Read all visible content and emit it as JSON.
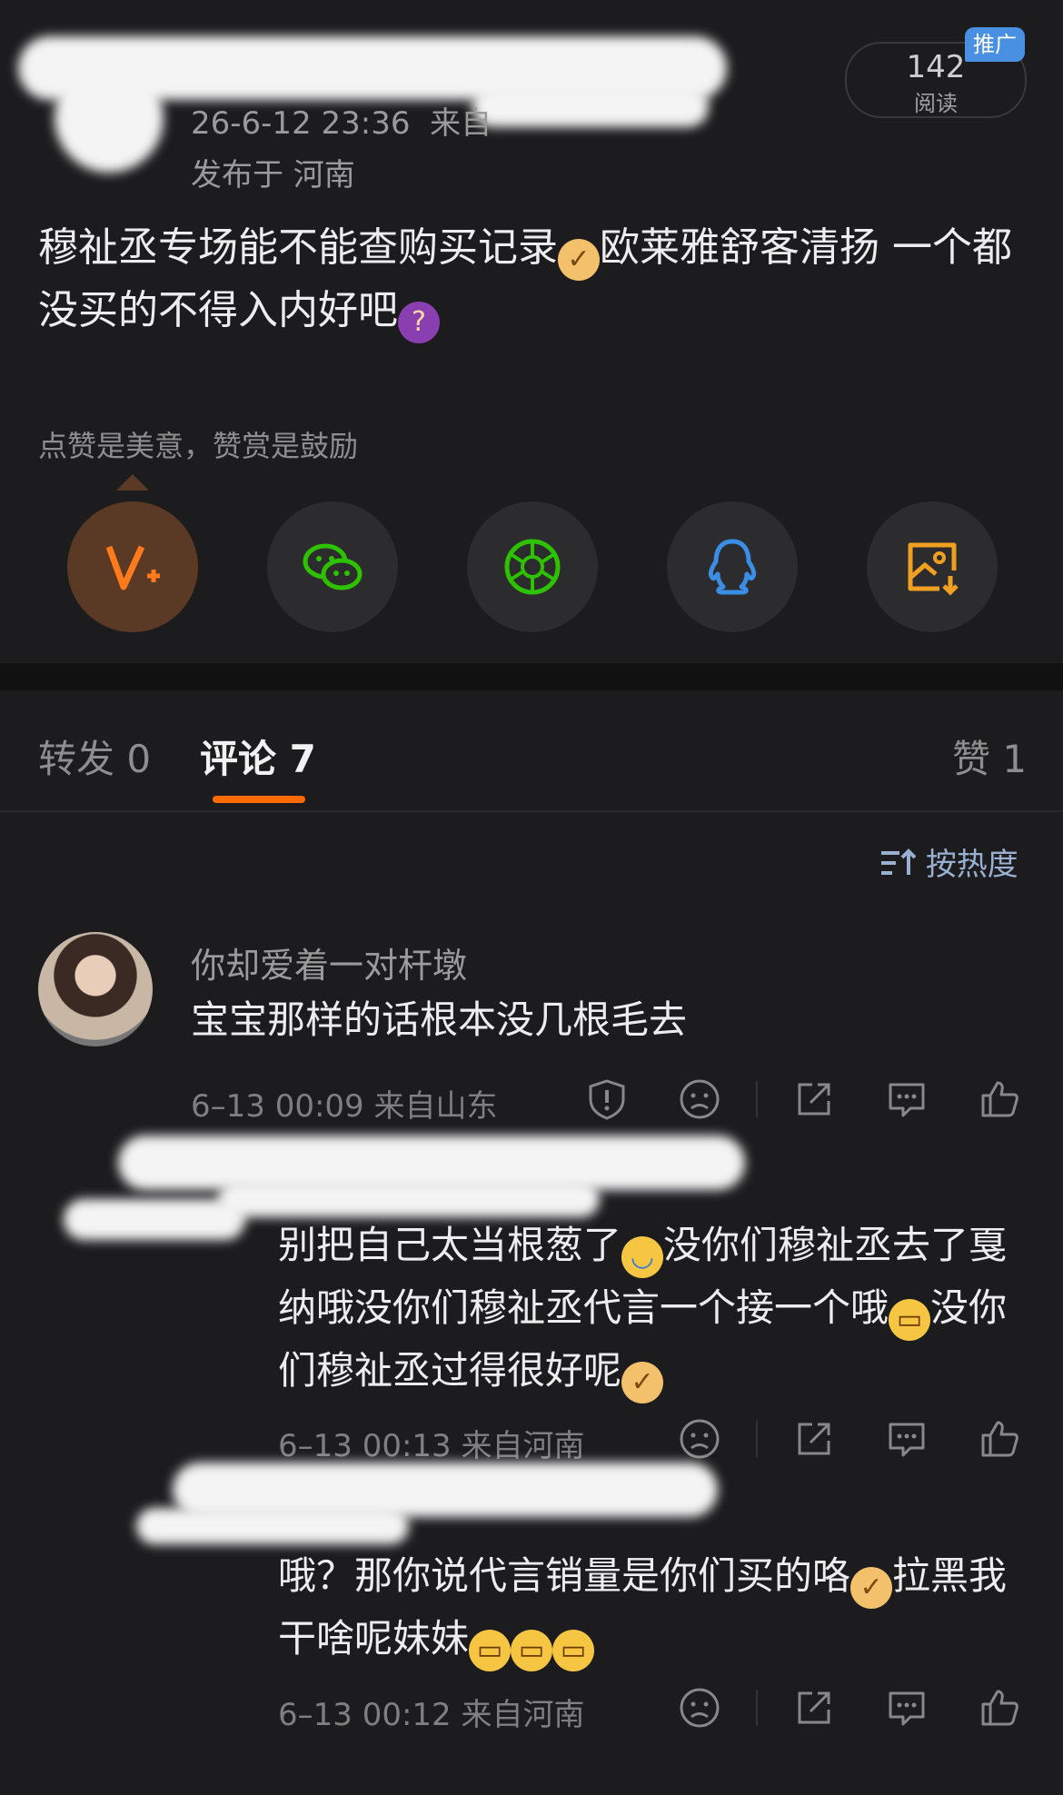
{
  "post": {
    "timestamp": "26-6-12 23:36",
    "source_prefix": "来自",
    "location": "发布于 河南",
    "read_count": "142",
    "read_label": "阅读",
    "promo_badge": "推广",
    "text_part1": "穆祉丞专场能不能查购买记录",
    "text_part2": "欧莱雅舒客清扬 一个都没买的不得入内好吧",
    "reward_hint": "点赞是美意，赞赏是鼓励"
  },
  "share_buttons": [
    {
      "name": "v-plus-icon",
      "color": "#ff7a1a"
    },
    {
      "name": "wechat-icon",
      "color": "#2dc100"
    },
    {
      "name": "moments-icon",
      "color": "#2dc100"
    },
    {
      "name": "qq-icon",
      "color": "#3a8ee6"
    },
    {
      "name": "save-image-icon",
      "color": "#f0a020"
    }
  ],
  "tabs": {
    "repost": "转发 0",
    "comments": "评论 7",
    "likes": "赞 1"
  },
  "sort_label": "按热度",
  "comments": [
    {
      "username": "你却爱着一对杆墩",
      "text": "宝宝那样的话根本没几根毛去",
      "time": "6–13 00:09",
      "from": "来自山东"
    },
    {
      "text_part1": "别把自己太当根葱了",
      "text_part2": "没你们穆祉丞去了戛纳哦没你们穆祉丞代言一个接一个哦",
      "text_part3": "没你们穆祉丞过得很好呢",
      "time": "6–13 00:13",
      "from": "来自河南"
    },
    {
      "text_part1": "哦？那你说代言销量是你们买的咯",
      "text_part2": "拉黑我干啥呢妹妹",
      "time": "6–13 00:12",
      "from": "来自河南"
    }
  ],
  "colors": {
    "background": "#1c1c1e",
    "accent": "#ff6a00",
    "promo": "#4a90e2"
  }
}
